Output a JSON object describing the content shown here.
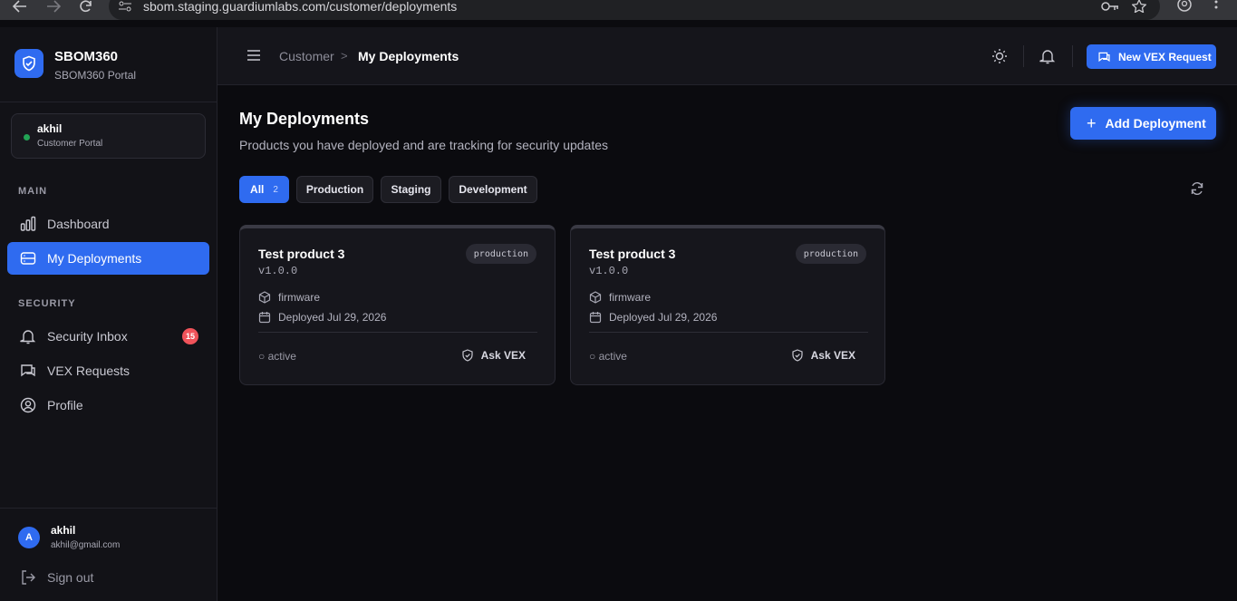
{
  "browser": {
    "url": "sbom.staging.guardiumlabs.com/customer/deployments"
  },
  "sidebar": {
    "brand_title": "SBOM360",
    "brand_subtitle": "SBOM360 Portal",
    "user_card": {
      "name": "akhil",
      "role": "Customer Portal"
    },
    "main_label": "MAIN",
    "security_label": "SECURITY",
    "items": [
      {
        "label": "Dashboard",
        "icon": "bar-chart-icon"
      },
      {
        "label": "My Deployments",
        "icon": "server-icon",
        "active": true
      },
      {
        "label": "Security Inbox",
        "icon": "bell-icon",
        "badge": "15"
      },
      {
        "label": "VEX Requests",
        "icon": "message-icon"
      },
      {
        "label": "Profile",
        "icon": "user-circle-icon"
      }
    ],
    "footer": {
      "avatar_initial": "A",
      "name": "akhil",
      "email": "akhil@gmail.com",
      "sign_out": "Sign out"
    }
  },
  "header": {
    "breadcrumb_root": "Customer",
    "breadcrumb_sep": ">",
    "breadcrumb_current": "My Deployments",
    "vex_button": "New VEX Request"
  },
  "main": {
    "title": "My Deployments",
    "subtitle": "Products you have deployed and are tracking for security updates",
    "add_button": "Add Deployment",
    "filters": [
      {
        "label": "All",
        "count": "2",
        "active": true
      },
      {
        "label": "Production"
      },
      {
        "label": "Staging"
      },
      {
        "label": "Development"
      }
    ],
    "cards": [
      {
        "name": "Test product 3",
        "version": "v1.0.0",
        "env": "production",
        "type": "firmware",
        "deployed": "Deployed Jul 29, 2026",
        "status": "○ active",
        "action": "Ask VEX"
      },
      {
        "name": "Test product 3",
        "version": "v1.0.0",
        "env": "production",
        "type": "firmware",
        "deployed": "Deployed Jul 29, 2026",
        "status": "○ active",
        "action": "Ask VEX"
      }
    ]
  },
  "colors": {
    "accent": "#2f6bf0",
    "badge": "#f0535a",
    "online": "#22a355"
  }
}
